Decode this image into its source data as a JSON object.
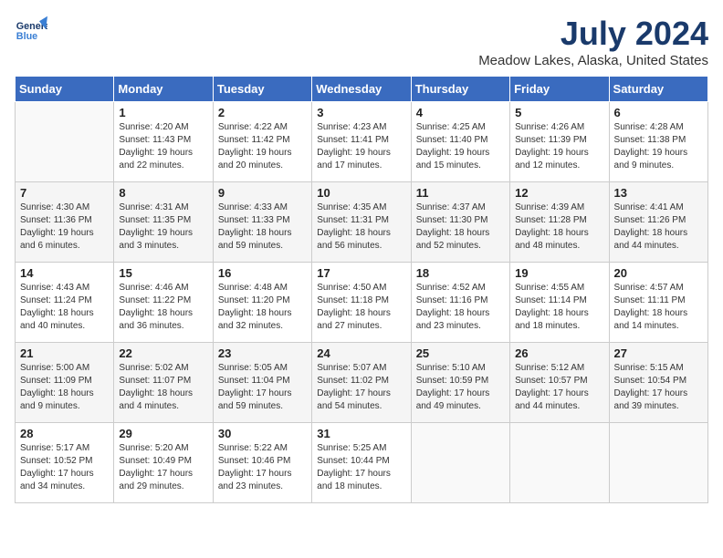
{
  "header": {
    "logo_line1": "General",
    "logo_line2": "Blue",
    "month_year": "July 2024",
    "location": "Meadow Lakes, Alaska, United States"
  },
  "weekdays": [
    "Sunday",
    "Monday",
    "Tuesday",
    "Wednesday",
    "Thursday",
    "Friday",
    "Saturday"
  ],
  "weeks": [
    [
      {
        "day": "",
        "info": ""
      },
      {
        "day": "1",
        "info": "Sunrise: 4:20 AM\nSunset: 11:43 PM\nDaylight: 19 hours\nand 22 minutes."
      },
      {
        "day": "2",
        "info": "Sunrise: 4:22 AM\nSunset: 11:42 PM\nDaylight: 19 hours\nand 20 minutes."
      },
      {
        "day": "3",
        "info": "Sunrise: 4:23 AM\nSunset: 11:41 PM\nDaylight: 19 hours\nand 17 minutes."
      },
      {
        "day": "4",
        "info": "Sunrise: 4:25 AM\nSunset: 11:40 PM\nDaylight: 19 hours\nand 15 minutes."
      },
      {
        "day": "5",
        "info": "Sunrise: 4:26 AM\nSunset: 11:39 PM\nDaylight: 19 hours\nand 12 minutes."
      },
      {
        "day": "6",
        "info": "Sunrise: 4:28 AM\nSunset: 11:38 PM\nDaylight: 19 hours\nand 9 minutes."
      }
    ],
    [
      {
        "day": "7",
        "info": "Sunrise: 4:30 AM\nSunset: 11:36 PM\nDaylight: 19 hours\nand 6 minutes."
      },
      {
        "day": "8",
        "info": "Sunrise: 4:31 AM\nSunset: 11:35 PM\nDaylight: 19 hours\nand 3 minutes."
      },
      {
        "day": "9",
        "info": "Sunrise: 4:33 AM\nSunset: 11:33 PM\nDaylight: 18 hours\nand 59 minutes."
      },
      {
        "day": "10",
        "info": "Sunrise: 4:35 AM\nSunset: 11:31 PM\nDaylight: 18 hours\nand 56 minutes."
      },
      {
        "day": "11",
        "info": "Sunrise: 4:37 AM\nSunset: 11:30 PM\nDaylight: 18 hours\nand 52 minutes."
      },
      {
        "day": "12",
        "info": "Sunrise: 4:39 AM\nSunset: 11:28 PM\nDaylight: 18 hours\nand 48 minutes."
      },
      {
        "day": "13",
        "info": "Sunrise: 4:41 AM\nSunset: 11:26 PM\nDaylight: 18 hours\nand 44 minutes."
      }
    ],
    [
      {
        "day": "14",
        "info": "Sunrise: 4:43 AM\nSunset: 11:24 PM\nDaylight: 18 hours\nand 40 minutes."
      },
      {
        "day": "15",
        "info": "Sunrise: 4:46 AM\nSunset: 11:22 PM\nDaylight: 18 hours\nand 36 minutes."
      },
      {
        "day": "16",
        "info": "Sunrise: 4:48 AM\nSunset: 11:20 PM\nDaylight: 18 hours\nand 32 minutes."
      },
      {
        "day": "17",
        "info": "Sunrise: 4:50 AM\nSunset: 11:18 PM\nDaylight: 18 hours\nand 27 minutes."
      },
      {
        "day": "18",
        "info": "Sunrise: 4:52 AM\nSunset: 11:16 PM\nDaylight: 18 hours\nand 23 minutes."
      },
      {
        "day": "19",
        "info": "Sunrise: 4:55 AM\nSunset: 11:14 PM\nDaylight: 18 hours\nand 18 minutes."
      },
      {
        "day": "20",
        "info": "Sunrise: 4:57 AM\nSunset: 11:11 PM\nDaylight: 18 hours\nand 14 minutes."
      }
    ],
    [
      {
        "day": "21",
        "info": "Sunrise: 5:00 AM\nSunset: 11:09 PM\nDaylight: 18 hours\nand 9 minutes."
      },
      {
        "day": "22",
        "info": "Sunrise: 5:02 AM\nSunset: 11:07 PM\nDaylight: 18 hours\nand 4 minutes."
      },
      {
        "day": "23",
        "info": "Sunrise: 5:05 AM\nSunset: 11:04 PM\nDaylight: 17 hours\nand 59 minutes."
      },
      {
        "day": "24",
        "info": "Sunrise: 5:07 AM\nSunset: 11:02 PM\nDaylight: 17 hours\nand 54 minutes."
      },
      {
        "day": "25",
        "info": "Sunrise: 5:10 AM\nSunset: 10:59 PM\nDaylight: 17 hours\nand 49 minutes."
      },
      {
        "day": "26",
        "info": "Sunrise: 5:12 AM\nSunset: 10:57 PM\nDaylight: 17 hours\nand 44 minutes."
      },
      {
        "day": "27",
        "info": "Sunrise: 5:15 AM\nSunset: 10:54 PM\nDaylight: 17 hours\nand 39 minutes."
      }
    ],
    [
      {
        "day": "28",
        "info": "Sunrise: 5:17 AM\nSunset: 10:52 PM\nDaylight: 17 hours\nand 34 minutes."
      },
      {
        "day": "29",
        "info": "Sunrise: 5:20 AM\nSunset: 10:49 PM\nDaylight: 17 hours\nand 29 minutes."
      },
      {
        "day": "30",
        "info": "Sunrise: 5:22 AM\nSunset: 10:46 PM\nDaylight: 17 hours\nand 23 minutes."
      },
      {
        "day": "31",
        "info": "Sunrise: 5:25 AM\nSunset: 10:44 PM\nDaylight: 17 hours\nand 18 minutes."
      },
      {
        "day": "",
        "info": ""
      },
      {
        "day": "",
        "info": ""
      },
      {
        "day": "",
        "info": ""
      }
    ]
  ]
}
